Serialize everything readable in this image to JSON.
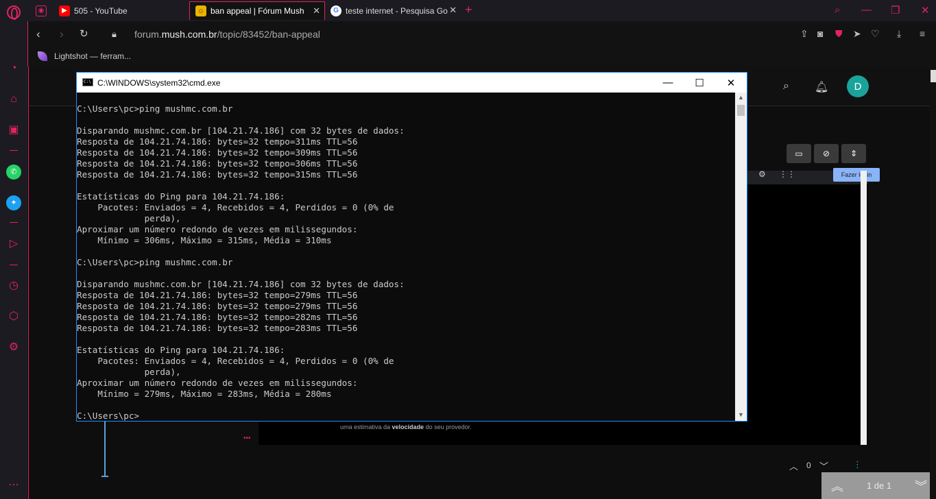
{
  "tabs": [
    {
      "title": "",
      "favicon": "gamepad-icon"
    },
    {
      "title": "505 - YouTube",
      "favicon": "youtube-icon"
    },
    {
      "title": "ban appeal | Fórum Mush",
      "favicon": "mush-icon",
      "active": true
    },
    {
      "title": "teste internet - Pesquisa Go",
      "favicon": "google-icon"
    }
  ],
  "address": {
    "url_prefix": "forum.",
    "url_domain": "mush.com.br",
    "url_path": "/topic/83452/ban-appeal"
  },
  "bookmarks": [
    {
      "label": "Lightshot — ferram..."
    }
  ],
  "forum": {
    "avatar_letter": "D",
    "login_button": "Fazer login",
    "embed_caption_pre": "uma estimativa da ",
    "embed_caption_bold": "velocidade",
    "embed_caption_post": " do seu provedor.",
    "vote_count": "0",
    "pager_label": "1 de 1"
  },
  "cmd": {
    "title": "C:\\WINDOWS\\system32\\cmd.exe",
    "lines": [
      "C:\\Users\\pc>ping mushmc.com.br",
      "",
      "Disparando mushmc.com.br [104.21.74.186] com 32 bytes de dados:",
      "Resposta de 104.21.74.186: bytes=32 tempo=311ms TTL=56",
      "Resposta de 104.21.74.186: bytes=32 tempo=309ms TTL=56",
      "Resposta de 104.21.74.186: bytes=32 tempo=306ms TTL=56",
      "Resposta de 104.21.74.186: bytes=32 tempo=315ms TTL=56",
      "",
      "Estatísticas do Ping para 104.21.74.186:",
      "    Pacotes: Enviados = 4, Recebidos = 4, Perdidos = 0 (0% de",
      "             perda),",
      "Aproximar um número redondo de vezes em milissegundos:",
      "    Mínimo = 306ms, Máximo = 315ms, Média = 310ms",
      "",
      "C:\\Users\\pc>ping mushmc.com.br",
      "",
      "Disparando mushmc.com.br [104.21.74.186] com 32 bytes de dados:",
      "Resposta de 104.21.74.186: bytes=32 tempo=279ms TTL=56",
      "Resposta de 104.21.74.186: bytes=32 tempo=279ms TTL=56",
      "Resposta de 104.21.74.186: bytes=32 tempo=282ms TTL=56",
      "Resposta de 104.21.74.186: bytes=32 tempo=283ms TTL=56",
      "",
      "Estatísticas do Ping para 104.21.74.186:",
      "    Pacotes: Enviados = 4, Recebidos = 4, Perdidos = 0 (0% de",
      "             perda),",
      "Aproximar um número redondo de vezes em milissegundos:",
      "    Mínimo = 279ms, Máximo = 283ms, Média = 280ms",
      "",
      "C:\\Users\\pc>"
    ]
  },
  "colors": {
    "accent": "#e0245e",
    "terminal_bg": "#0c0c0c",
    "terminal_fg": "#cccccc"
  }
}
